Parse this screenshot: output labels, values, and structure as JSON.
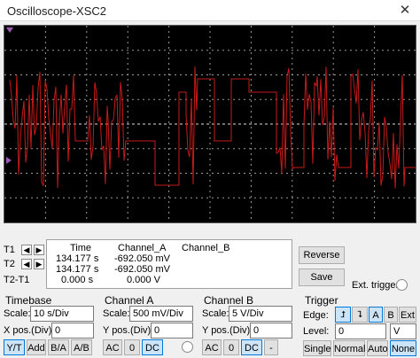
{
  "window": {
    "title": "Oscilloscope-XSC2",
    "close_glyph": "✕"
  },
  "cursors": {
    "t1_label": "T1",
    "t2_label": "T2",
    "t2t1_label": "T2-T1",
    "left_arrow": "◀",
    "right_arrow": "▶"
  },
  "readout": {
    "headers": {
      "time": "Time",
      "channel_a": "Channel_A",
      "channel_b": "Channel_B"
    },
    "rows": [
      {
        "time": "134.177 s",
        "channel_a": "-692.050 mV",
        "channel_b": ""
      },
      {
        "time": "134.177 s",
        "channel_a": "-692.050 mV",
        "channel_b": ""
      },
      {
        "time": "0.000 s",
        "channel_a": "0.000 V",
        "channel_b": ""
      }
    ]
  },
  "actions": {
    "reverse": "Reverse",
    "save": "Save",
    "ext_trigger": "Ext. trigger"
  },
  "timebase": {
    "label": "Timebase",
    "scale_label": "Scale:",
    "scale_value": "10  s/Div",
    "xpos_label": "X pos.(Div):",
    "xpos_value": "0",
    "modes": [
      "Y/T",
      "Add",
      "B/A",
      "A/B"
    ],
    "active_mode": "Y/T"
  },
  "channel_a": {
    "label": "Channel A",
    "scale_label": "Scale:",
    "scale_value": "500  mV/Div",
    "ypos_label": "Y pos.(Div):",
    "ypos_value": "0",
    "coupling": [
      "AC",
      "0",
      "DC"
    ],
    "active_coupling": "DC"
  },
  "channel_b": {
    "label": "Channel B",
    "scale_label": "Scale:",
    "scale_value": "5  V/Div",
    "ypos_label": "Y pos.(Div):",
    "ypos_value": "0",
    "coupling": [
      "AC",
      "0",
      "DC",
      "-"
    ],
    "active_coupling": "DC"
  },
  "trigger": {
    "label": "Trigger",
    "edge_label": "Edge:",
    "edge_rise": "⮥",
    "edge_fall": "⮧",
    "sources": [
      "A",
      "B",
      "Ext"
    ],
    "active_source": "A",
    "level_label": "Level:",
    "level_value": "0",
    "level_unit": "V",
    "modes": [
      "Single",
      "Normal",
      "Auto",
      "None"
    ],
    "active_mode": "None"
  },
  "colors": {
    "trace": "#c81a1a",
    "grid": "#9a9a9a",
    "screen_bg": "#000000",
    "accent": "#0078d7",
    "cursor_marker": "#9b59b6"
  }
}
